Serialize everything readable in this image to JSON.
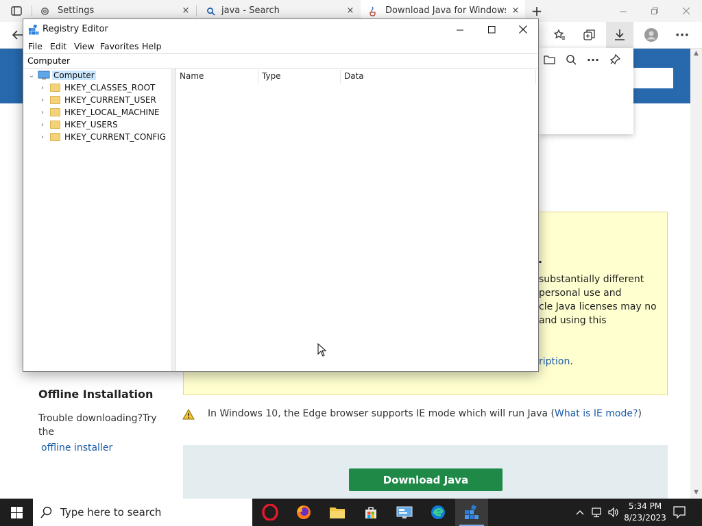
{
  "browser": {
    "tabs": [
      {
        "label": "Settings",
        "icon": "gear-icon"
      },
      {
        "label": "java - Search",
        "icon": "search-icon"
      },
      {
        "label": "Download Java for Windows",
        "icon": "java-icon"
      }
    ],
    "new_tab_symbol": "+",
    "close_symbol": "×"
  },
  "registry_editor": {
    "title": "Registry Editor",
    "menu": [
      "File",
      "Edit",
      "View",
      "Favorites",
      "Help"
    ],
    "address": "Computer",
    "tree_root": "Computer",
    "hives": [
      "HKEY_CLASSES_ROOT",
      "HKEY_CURRENT_USER",
      "HKEY_LOCAL_MACHINE",
      "HKEY_USERS",
      "HKEY_CURRENT_CONFIG"
    ],
    "columns": [
      "Name",
      "Type",
      "Data"
    ]
  },
  "page": {
    "notice_lines": [
      "substantially different",
      "personal use and",
      "cle Java licenses may no",
      "and using this"
    ],
    "notice_tail": ".",
    "notice_link_text": "ription",
    "offline_heading": "Offline Installation",
    "offline_text_1": "Trouble downloading?Try",
    "offline_text_2": "the",
    "offline_link": "offline installer",
    "ie_note": "In Windows 10, the Edge browser supports IE mode which will run Java (",
    "ie_link": "What is IE mode?",
    "ie_note_end": ")",
    "download_button": "Download Java"
  },
  "taskbar": {
    "search_placeholder": "Type here to search",
    "time": "5:34 PM",
    "date": "8/23/2023"
  },
  "colors": {
    "java_blue": "#2869ad",
    "download_green": "#1f8a48",
    "notice_yellow": "#ffffd0",
    "taskbar": "#1e1e1e"
  }
}
